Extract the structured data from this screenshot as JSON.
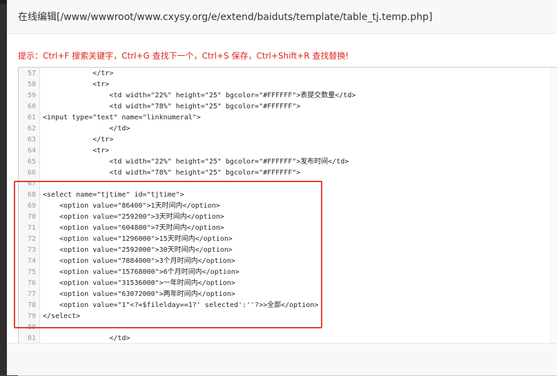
{
  "dialog": {
    "title": "在线编辑[/www/wwwroot/www.cxysy.org/e/extend/baiduts/template/table_tj.temp.php]",
    "hint": "提示：Ctrl+F 搜索关键字，Ctrl+G 查找下一个，Ctrl+S 保存，Ctrl+Shift+R 查找替换!"
  },
  "editor": {
    "lines": [
      {
        "num": "57",
        "code": "            </tr>"
      },
      {
        "num": "58",
        "code": "            <tr>"
      },
      {
        "num": "59",
        "code": "                <td width=\"22%\" height=\"25\" bgcolor=\"#FFFFFF\">表提交数量</td>"
      },
      {
        "num": "60",
        "code": "                <td width=\"78%\" height=\"25\" bgcolor=\"#FFFFFF\">"
      },
      {
        "num": "61",
        "code": "<input type=\"text\" name=\"linknumeral\">"
      },
      {
        "num": "62",
        "code": "                </td>"
      },
      {
        "num": "63",
        "code": "            </tr>"
      },
      {
        "num": "64",
        "code": "            <tr>"
      },
      {
        "num": "65",
        "code": "                <td width=\"22%\" height=\"25\" bgcolor=\"#FFFFFF\">发布时间</td>"
      },
      {
        "num": "66",
        "code": "                <td width=\"78%\" height=\"25\" bgcolor=\"#FFFFFF\">"
      },
      {
        "num": "67",
        "code": ""
      },
      {
        "num": "68",
        "code": "<select name=\"tjtime\" id=\"tjtime\">"
      },
      {
        "num": "69",
        "code": "    <option value=\"86400\">1天时间内</option>"
      },
      {
        "num": "70",
        "code": "    <option value=\"259200\">3天时间内</option>"
      },
      {
        "num": "71",
        "code": "    <option value=\"604800\">7天时间内</option>"
      },
      {
        "num": "72",
        "code": "    <option value=\"1296000\">15天时间内</option>"
      },
      {
        "num": "73",
        "code": "    <option value=\"2592000\">30天时间内</option>"
      },
      {
        "num": "74",
        "code": "    <option value=\"7884000\">3个月时间内</option>"
      },
      {
        "num": "75",
        "code": "    <option value=\"15768000\">6个月时间内</option>"
      },
      {
        "num": "76",
        "code": "    <option value=\"31536000\">一年时间内</option>"
      },
      {
        "num": "77",
        "code": "    <option value=\"63072000\">两年时间内</option>"
      },
      {
        "num": "78",
        "code": "    <option value=\"1\"<?=$filelday==1?' selected':''?>>全部</option>"
      },
      {
        "num": "79",
        "code": "</select>"
      },
      {
        "num": "80",
        "code": ""
      },
      {
        "num": "81",
        "code": "                </td>"
      }
    ]
  }
}
